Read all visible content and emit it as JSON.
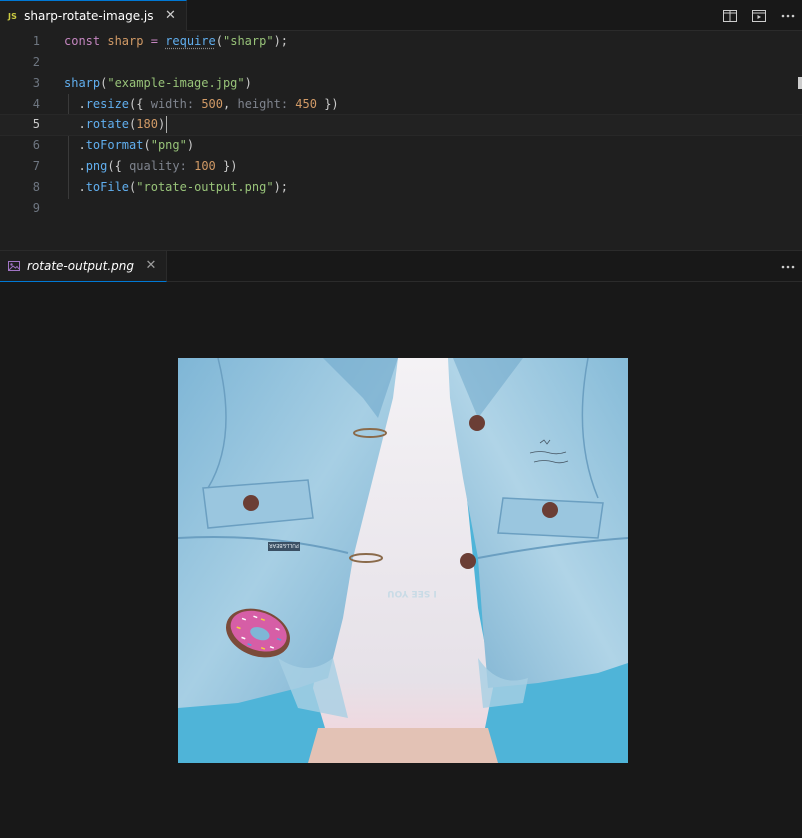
{
  "editor_tab": {
    "badge": "JS",
    "filename": "sharp-rotate-image.js",
    "close": "✕"
  },
  "editor_actions": [
    "split-editor-icon",
    "open-preview-icon",
    "more-actions-icon"
  ],
  "code_lines": [
    {
      "n": "1"
    },
    {
      "n": "2"
    },
    {
      "n": "3"
    },
    {
      "n": "4"
    },
    {
      "n": "5"
    },
    {
      "n": "6"
    },
    {
      "n": "7"
    },
    {
      "n": "8"
    },
    {
      "n": "9"
    }
  ],
  "code": {
    "l1": {
      "kw": "const",
      "var": "sharp",
      "eq": "=",
      "fn": "require",
      "open": "(",
      "str": "\"sharp\"",
      "close": ");"
    },
    "l3": {
      "fn": "sharp",
      "open": "(",
      "str": "\"example-image.jpg\"",
      "close": ")"
    },
    "l4": {
      "dot": ".",
      "fn": "resize",
      "open": "({ ",
      "k1": "width:",
      "v1": "500",
      "comma": ", ",
      "k2": "height:",
      "v2": "450",
      "close": " })"
    },
    "l5": {
      "dot": ".",
      "fn": "rotate",
      "open": "(",
      "v": "180",
      "close": ")"
    },
    "l6": {
      "dot": ".",
      "fn": "toFormat",
      "open": "(",
      "str": "\"png\"",
      "close": ")"
    },
    "l7": {
      "dot": ".",
      "fn": "png",
      "open": "({ ",
      "k": "quality:",
      "v": "100",
      "close": " })"
    },
    "l8": {
      "dot": ".",
      "fn": "toFile",
      "open": "(",
      "str": "\"rotate-output.png\"",
      "close": ");"
    }
  },
  "current_line": "5",
  "preview_tab": {
    "filename": "rotate-output.png",
    "close": "✕"
  },
  "preview_actions": [
    "more-actions-icon"
  ],
  "image": {
    "description_colors": {
      "denim": "#8fc0dc",
      "background": "#4fb4d8",
      "shirt": "#ece8ee"
    },
    "jacket_print": "I SEE YOU",
    "label_text": "PULL&BEAR"
  },
  "colors": {
    "accent": "#0078d4",
    "js_badge": "#cbcb41",
    "keyword": "#c586c0",
    "string": "#98c379",
    "number": "#d19a66",
    "function": "#61afef"
  }
}
